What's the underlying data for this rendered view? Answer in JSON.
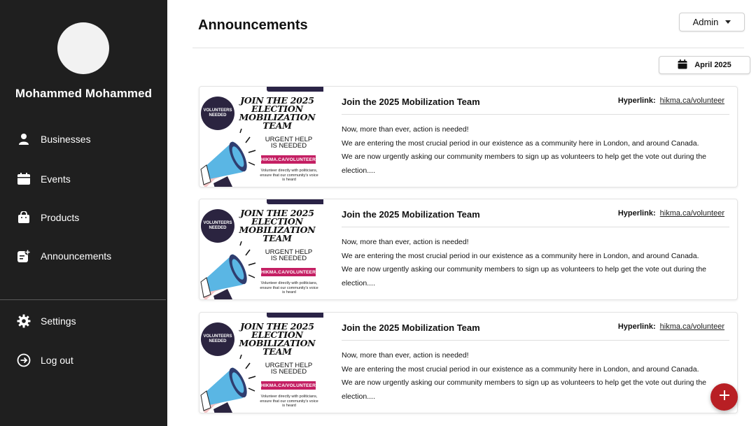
{
  "user": {
    "name": "Mohammed Mohammed"
  },
  "nav": {
    "items": [
      {
        "label": "Businesses",
        "icon": "person-icon"
      },
      {
        "label": "Events",
        "icon": "calendar-icon"
      },
      {
        "label": "Products",
        "icon": "shopping-bag-icon"
      },
      {
        "label": "Announcements",
        "icon": "announcement-add-icon"
      }
    ],
    "bottom": [
      {
        "label": "Settings",
        "icon": "gear-icon"
      },
      {
        "label": "Log out",
        "icon": "logout-icon"
      }
    ]
  },
  "header": {
    "title": "Announcements",
    "role_select": "Admin",
    "date_filter": "April 2025"
  },
  "poster": {
    "badge": "VOLUNTEERS NEEDED",
    "headline": "JOIN THE 2025 ELECTION MOBILIZATION TEAM",
    "urgent": "URGENT HELP IS NEEDED",
    "tag": "HIKMA.CA/VOLUNTEER",
    "small": "Volunteer directly with politicians, ensure that our community's voice is heard"
  },
  "announcements": [
    {
      "title": "Join the 2025 Mobilization Team",
      "hyperlink_label": "Hyperlink:",
      "hyperlink": "hikma.ca/volunteer",
      "body": [
        "Now, more than ever, action is needed!",
        "We are entering the most crucial period in our existence as a community here in London, and around Canada.",
        "We are now urgently asking our community members to sign up as volunteers to help get the vote out during the election...."
      ]
    },
    {
      "title": "Join the 2025 Mobilization Team",
      "hyperlink_label": "Hyperlink:",
      "hyperlink": "hikma.ca/volunteer",
      "body": [
        "Now, more than ever, action is needed!",
        "We are entering the most crucial period in our existence as a community here in London, and around Canada.",
        "We are now urgently asking our community members to sign up as volunteers to help get the vote out during the election...."
      ]
    },
    {
      "title": "Join the 2025 Mobilization Team",
      "hyperlink_label": "Hyperlink:",
      "hyperlink": "hikma.ca/volunteer",
      "body": [
        "Now, more than ever, action is needed!",
        "We are entering the most crucial period in our existence as a community here in London, and around Canada.",
        "We are now urgently asking our community members to sign up as volunteers to help get the vote out during the election...."
      ]
    }
  ],
  "fab": {
    "icon": "plus-icon"
  },
  "colors": {
    "sidebar": "#1f1f1f",
    "accent": "#b81f24",
    "poster_tag": "#c41f63"
  }
}
